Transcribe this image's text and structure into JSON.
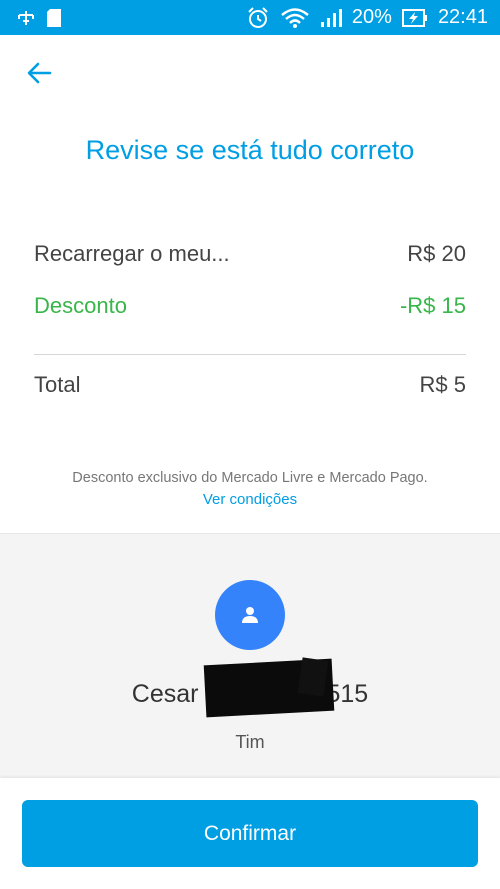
{
  "status_bar": {
    "battery": "20%",
    "time": "22:41",
    "icons": [
      "usb-icon",
      "sd-card-icon",
      "alarm-icon",
      "wifi-icon",
      "signal-icon",
      "battery-charging-icon"
    ]
  },
  "colors": {
    "primary": "#009ee3",
    "discount": "#39b54a",
    "avatar": "#3483fa"
  },
  "header": {
    "back_icon": "arrow-left-icon",
    "title": "Revise se está tudo correto"
  },
  "summary": {
    "items": [
      {
        "label": "Recarregar o meu...",
        "value": "R$ 20"
      },
      {
        "label": "Desconto",
        "value": "-R$ 15"
      }
    ],
    "total": {
      "label": "Total",
      "value": "R$ 5"
    }
  },
  "disclaimer": {
    "text": "Desconto exclusivo do Mercado Livre e Mercado Pago.",
    "link": "Ver condições"
  },
  "recipient": {
    "avatar_icon": "person-icon",
    "name_prefix": "Cesar",
    "name_suffix": "515",
    "carrier": "Tim"
  },
  "footer": {
    "confirm_label": "Confirmar"
  }
}
